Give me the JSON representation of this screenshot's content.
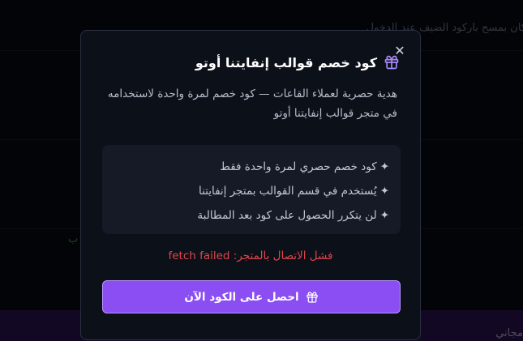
{
  "background": {
    "top_text": "كان بمسح باركود الضيف عند الدخول",
    "bottom_text": "مجاني",
    "side_text": "ب"
  },
  "modal": {
    "close_icon": "close-icon",
    "title_icon": "gift-icon",
    "title": "كود خصم قوالب إنفايتنا أوتو",
    "description": "هدية حصرية لعملاء القاعات — كود خصم لمرة واحدة لاستخدامه في متجر قوالب إنفايتنا أوتو",
    "features": [
      "كود خصم حصري لمرة واحدة فقط",
      "يُستخدم في قسم القوالب بمتجر إنفايتنا",
      "لن يتكرر الحصول على كود بعد المطالبة"
    ],
    "feature_bullet": "✦",
    "error": "فشل الاتصال بالمتجر: fetch failed",
    "cta_label": "احصل على الكود الآن",
    "cta_icon": "gift-icon",
    "colors": {
      "accent": "#8a4ef2",
      "accent_border": "#b895ff",
      "error": "#e0454a",
      "gift_icon": "#a78bfa"
    }
  }
}
